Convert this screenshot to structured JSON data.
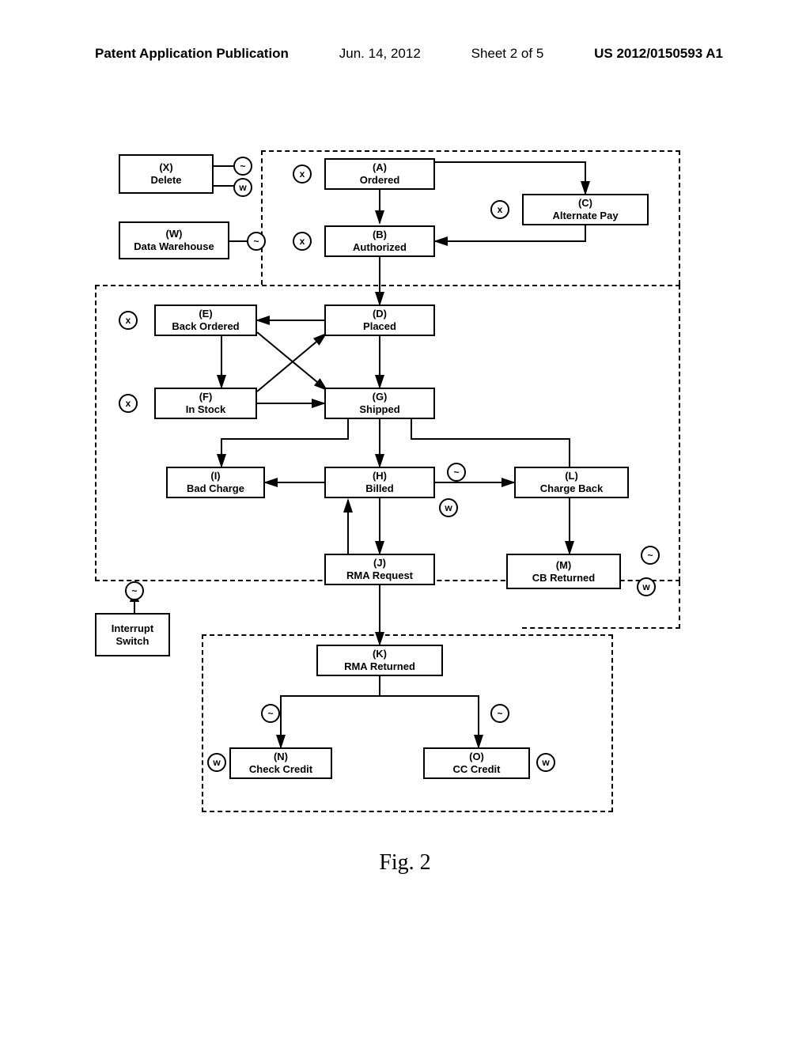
{
  "header": {
    "publication": "Patent Application Publication",
    "date": "Jun. 14, 2012",
    "sheet": "Sheet 2 of 5",
    "pubnum": "US 2012/0150593 A1"
  },
  "figure_label": "Fig. 2",
  "nodes": {
    "X": {
      "code": "(X)",
      "label": "Delete"
    },
    "W": {
      "code": "(W)",
      "label": "Data Warehouse"
    },
    "A": {
      "code": "(A)",
      "label": "Ordered"
    },
    "B": {
      "code": "(B)",
      "label": "Authorized"
    },
    "C": {
      "code": "(C)",
      "label": "Alternate Pay"
    },
    "D": {
      "code": "(D)",
      "label": "Placed"
    },
    "E": {
      "code": "(E)",
      "label": "Back Ordered"
    },
    "F": {
      "code": "(F)",
      "label": "In Stock"
    },
    "G": {
      "code": "(G)",
      "label": "Shipped"
    },
    "H": {
      "code": "(H)",
      "label": "Billed"
    },
    "I": {
      "code": "(I)",
      "label": "Bad Charge"
    },
    "J": {
      "code": "(J)",
      "label": "RMA Request"
    },
    "K": {
      "code": "(K)",
      "label": "RMA Returned"
    },
    "L": {
      "code": "(L)",
      "label": "Charge Back"
    },
    "M": {
      "code": "(M)",
      "label": "CB Returned"
    },
    "N": {
      "code": "(N)",
      "label": "Check Credit"
    },
    "O": {
      "code": "(O)",
      "label": "CC Credit"
    },
    "INT": {
      "code": "",
      "label": "Interrupt\nSwitch"
    }
  },
  "symbols": {
    "x": "x",
    "w": "w",
    "tilde": "~"
  }
}
